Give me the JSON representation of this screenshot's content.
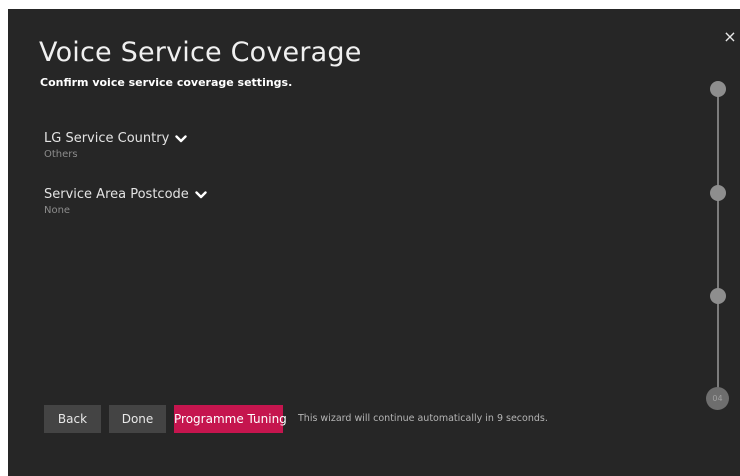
{
  "header": {
    "title": "Voice Service Coverage",
    "subtitle": "Confirm voice service coverage settings."
  },
  "settings": [
    {
      "label": "LG Service Country",
      "value": "Others",
      "icon": "chevron-down-icon"
    },
    {
      "label": "Service Area Postcode",
      "value": "None",
      "icon": "chevron-down-icon"
    }
  ],
  "close": {
    "glyph": "×",
    "icon": "close-icon"
  },
  "stepper": {
    "current_step": "04",
    "total_steps": 4
  },
  "buttons": {
    "back": "Back",
    "done": "Done",
    "programme_tuning": "Programme Tuning"
  },
  "footer": {
    "note": "This wizard will continue automatically in 9 seconds."
  },
  "colors": {
    "background": "#262626",
    "primary_button": "#c5154e",
    "secondary_button": "#444444"
  }
}
